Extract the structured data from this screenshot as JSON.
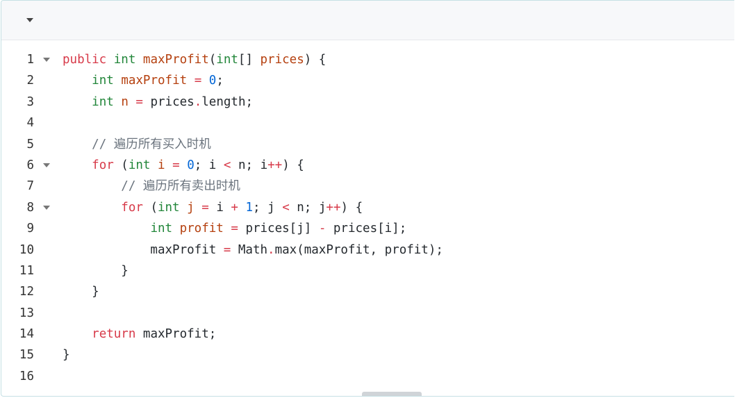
{
  "editor": {
    "language": "java",
    "lines": [
      {
        "n": "1",
        "fold": true,
        "tokens": [
          {
            "t": "public",
            "c": "kw"
          },
          {
            "t": " "
          },
          {
            "t": "int",
            "c": "ty"
          },
          {
            "t": " "
          },
          {
            "t": "maxProfit",
            "c": "fn"
          },
          {
            "t": "("
          },
          {
            "t": "int",
            "c": "ty"
          },
          {
            "t": "[] "
          },
          {
            "t": "prices",
            "c": "fn"
          },
          {
            "t": ") {"
          }
        ]
      },
      {
        "n": "2",
        "fold": false,
        "tokens": [
          {
            "t": "    "
          },
          {
            "t": "int",
            "c": "ty"
          },
          {
            "t": " "
          },
          {
            "t": "maxProfit",
            "c": "fn"
          },
          {
            "t": " "
          },
          {
            "t": "=",
            "c": "op"
          },
          {
            "t": " "
          },
          {
            "t": "0",
            "c": "nm"
          },
          {
            "t": ";"
          }
        ]
      },
      {
        "n": "3",
        "fold": false,
        "tokens": [
          {
            "t": "    "
          },
          {
            "t": "int",
            "c": "ty"
          },
          {
            "t": " "
          },
          {
            "t": "n",
            "c": "fn"
          },
          {
            "t": " "
          },
          {
            "t": "=",
            "c": "op"
          },
          {
            "t": " prices"
          },
          {
            "t": ".",
            "c": "op"
          },
          {
            "t": "length;"
          }
        ]
      },
      {
        "n": "4",
        "fold": false,
        "tokens": []
      },
      {
        "n": "5",
        "fold": false,
        "tokens": [
          {
            "t": "    "
          },
          {
            "t": "// 遍历所有买入时机",
            "c": "cm"
          }
        ]
      },
      {
        "n": "6",
        "fold": true,
        "tokens": [
          {
            "t": "    "
          },
          {
            "t": "for",
            "c": "kw"
          },
          {
            "t": " ("
          },
          {
            "t": "int",
            "c": "ty"
          },
          {
            "t": " "
          },
          {
            "t": "i",
            "c": "fn"
          },
          {
            "t": " "
          },
          {
            "t": "=",
            "c": "op"
          },
          {
            "t": " "
          },
          {
            "t": "0",
            "c": "nm"
          },
          {
            "t": "; i "
          },
          {
            "t": "<",
            "c": "op"
          },
          {
            "t": " n; i"
          },
          {
            "t": "++",
            "c": "op"
          },
          {
            "t": ") {"
          }
        ]
      },
      {
        "n": "7",
        "fold": false,
        "tokens": [
          {
            "t": "        "
          },
          {
            "t": "// 遍历所有卖出时机",
            "c": "cm"
          }
        ]
      },
      {
        "n": "8",
        "fold": true,
        "tokens": [
          {
            "t": "        "
          },
          {
            "t": "for",
            "c": "kw"
          },
          {
            "t": " ("
          },
          {
            "t": "int",
            "c": "ty"
          },
          {
            "t": " "
          },
          {
            "t": "j",
            "c": "fn"
          },
          {
            "t": " "
          },
          {
            "t": "=",
            "c": "op"
          },
          {
            "t": " i "
          },
          {
            "t": "+",
            "c": "op"
          },
          {
            "t": " "
          },
          {
            "t": "1",
            "c": "nm"
          },
          {
            "t": "; j "
          },
          {
            "t": "<",
            "c": "op"
          },
          {
            "t": " n; j"
          },
          {
            "t": "++",
            "c": "op"
          },
          {
            "t": ") {"
          }
        ]
      },
      {
        "n": "9",
        "fold": false,
        "tokens": [
          {
            "t": "            "
          },
          {
            "t": "int",
            "c": "ty"
          },
          {
            "t": " "
          },
          {
            "t": "profit",
            "c": "fn"
          },
          {
            "t": " "
          },
          {
            "t": "=",
            "c": "op"
          },
          {
            "t": " prices[j] "
          },
          {
            "t": "-",
            "c": "op"
          },
          {
            "t": " prices[i];"
          }
        ]
      },
      {
        "n": "10",
        "fold": false,
        "tokens": [
          {
            "t": "            maxProfit "
          },
          {
            "t": "=",
            "c": "op"
          },
          {
            "t": " Math"
          },
          {
            "t": ".",
            "c": "op"
          },
          {
            "t": "max(maxProfit, profit);"
          }
        ]
      },
      {
        "n": "11",
        "fold": false,
        "tokens": [
          {
            "t": "        }"
          }
        ]
      },
      {
        "n": "12",
        "fold": false,
        "tokens": [
          {
            "t": "    }"
          }
        ]
      },
      {
        "n": "13",
        "fold": false,
        "tokens": []
      },
      {
        "n": "14",
        "fold": false,
        "tokens": [
          {
            "t": "    "
          },
          {
            "t": "return",
            "c": "kw"
          },
          {
            "t": " maxProfit;"
          }
        ]
      },
      {
        "n": "15",
        "fold": false,
        "tokens": [
          {
            "t": "}"
          }
        ]
      },
      {
        "n": "16",
        "fold": false,
        "tokens": []
      }
    ]
  },
  "colors": {
    "keyword": "#d73a49",
    "type": "#22863a",
    "name": "#b5400f",
    "number": "#0366d6",
    "comment": "#6a737d",
    "border": "#c5e0e4"
  }
}
